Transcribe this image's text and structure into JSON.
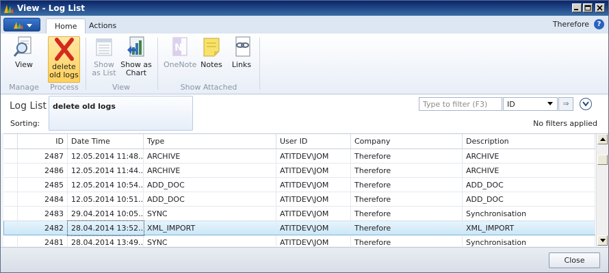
{
  "window": {
    "title": "View - Log List"
  },
  "ribbon": {
    "tabs": [
      {
        "label": "Home"
      },
      {
        "label": "Actions"
      }
    ],
    "company": "Therefore",
    "help_glyph": "?",
    "buttons": {
      "view": {
        "label": "View",
        "icon": "magnifier-document-icon"
      },
      "delete": {
        "line1": "delete",
        "line2": "old logs",
        "icon": "red-x-icon"
      },
      "show_list": {
        "line1": "Show",
        "line2": "as List",
        "icon": "list-icon"
      },
      "show_chart": {
        "line1": "Show as",
        "line2": "Chart",
        "icon": "chart-icon"
      },
      "onenote": {
        "label": "OneNote",
        "icon": "onenote-icon"
      },
      "notes": {
        "label": "Notes",
        "icon": "sticky-note-icon"
      },
      "links": {
        "label": "Links",
        "icon": "link-icon"
      }
    },
    "groups": [
      "Manage",
      "Process",
      "View",
      "Show Attached"
    ]
  },
  "page": {
    "title": "Log List",
    "action_popup": "delete old logs",
    "sorting_label": "Sorting:",
    "filter": {
      "placeholder": "Type to filter (F3)",
      "field": "ID",
      "apply_glyph": "⇒",
      "status": "No filters applied"
    }
  },
  "table": {
    "columns": [
      "ID",
      "Date Time",
      "Type",
      "User ID",
      "Company",
      "Description"
    ],
    "rows": [
      {
        "id": "2487",
        "datetime": "12.05.2014 11:48...",
        "type": "ARCHIVE",
        "user": "ATITDEV\\JOM",
        "company": "Therefore",
        "description": "ARCHIVE"
      },
      {
        "id": "2486",
        "datetime": "12.05.2014 11:44...",
        "type": "ARCHIVE",
        "user": "ATITDEV\\JOM",
        "company": "Therefore",
        "description": "ARCHIVE"
      },
      {
        "id": "2485",
        "datetime": "12.05.2014 10:54...",
        "type": "ADD_DOC",
        "user": "ATITDEV\\JOM",
        "company": "Therefore",
        "description": "ADD_DOC"
      },
      {
        "id": "2484",
        "datetime": "12.05.2014 10:51...",
        "type": "ADD_DOC",
        "user": "ATITDEV\\JOM",
        "company": "Therefore",
        "description": "ADD_DOC"
      },
      {
        "id": "2483",
        "datetime": "29.04.2014 10:05...",
        "type": "SYNC",
        "user": "ATITDEV\\JOM",
        "company": "Therefore",
        "description": "Synchronisation"
      },
      {
        "id": "2482",
        "datetime": "28.04.2014 13:52...",
        "type": "XML_IMPORT",
        "user": "ATITDEV\\JOM",
        "company": "Therefore",
        "description": "XML_IMPORT",
        "selected": true
      },
      {
        "id": "2481",
        "datetime": "28.04.2014 13:49...",
        "type": "SYNC",
        "user": "ATITDEV\\JOM",
        "company": "Therefore",
        "description": "Synchronisation"
      }
    ]
  },
  "footer": {
    "close_label": "Close"
  },
  "colors": {
    "accent": "#1b4f9c",
    "selected_row": "#c9e6f7",
    "delete_icon": "#d42a1e"
  }
}
